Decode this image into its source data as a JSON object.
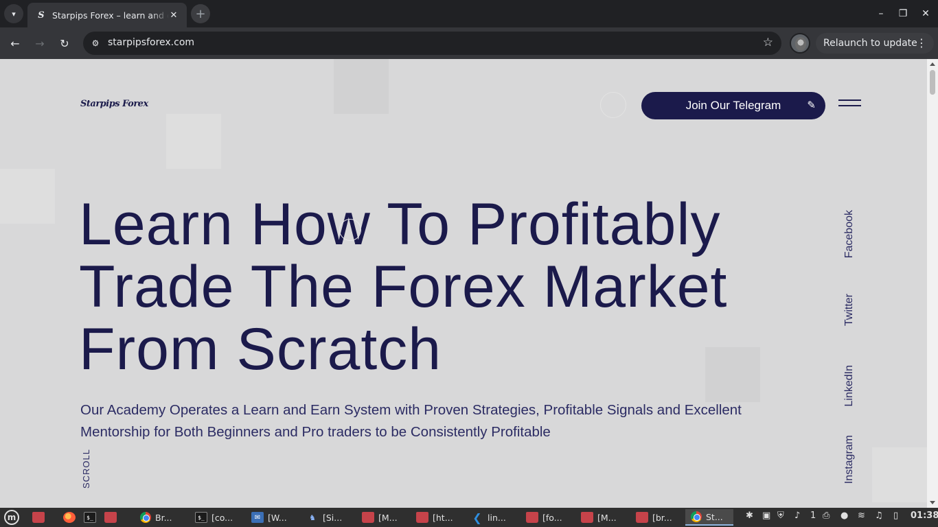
{
  "browser": {
    "tab": {
      "favicon": "S",
      "title": "Starpips Forex – learn and earn",
      "close": "✕"
    },
    "new_tab": "+",
    "window_controls": {
      "minimize": "–",
      "maximize": "❐",
      "close": "✕"
    },
    "nav": {
      "back": "←",
      "forward": "→",
      "reload": "↻"
    },
    "url": "starpipsforex.com",
    "bookmark": "☆",
    "relaunch_label": "Relaunch to update",
    "menu_dots": "⋮"
  },
  "page": {
    "logo": "Starpips Forex",
    "telegram_button": "Join Our Telegram",
    "hero": {
      "line1": "Learn How To Profitably",
      "line2": "Trade The Forex Market",
      "line3": "From Scratch",
      "subtitle": "Our Academy Operates a Learn and Earn System with Proven Strategies, Profitable Signals and Excellent Mentorship for Both Beginners and Pro traders to be Consistently Profitable"
    },
    "scroll_label": "SCROLL",
    "social": [
      "Facebook",
      "Twitter",
      "LinkedIn",
      "Instagram"
    ]
  },
  "taskbar": {
    "items": [
      {
        "icon": "folder-icon",
        "label": ""
      },
      {
        "icon": "firefox-icon",
        "label": ""
      },
      {
        "icon": "terminal-icon",
        "label": ""
      },
      {
        "icon": "folder-icon",
        "label": ""
      },
      {
        "icon": "chrome-icon",
        "label": "Br..."
      },
      {
        "icon": "terminal-icon",
        "label": "[co..."
      },
      {
        "icon": "mail-icon",
        "label": "[W..."
      },
      {
        "icon": "app-icon",
        "label": "[Si..."
      },
      {
        "icon": "folder-icon",
        "label": "[M..."
      },
      {
        "icon": "folder-icon",
        "label": "[ht..."
      },
      {
        "icon": "vscode-icon",
        "label": "lin..."
      },
      {
        "icon": "folder-icon",
        "label": "[fo..."
      },
      {
        "icon": "folder-icon",
        "label": "[M..."
      },
      {
        "icon": "folder-icon",
        "label": "[br..."
      },
      {
        "icon": "chrome-icon",
        "label": "St..."
      }
    ],
    "tray_count": "1",
    "clock": "01:38"
  }
}
